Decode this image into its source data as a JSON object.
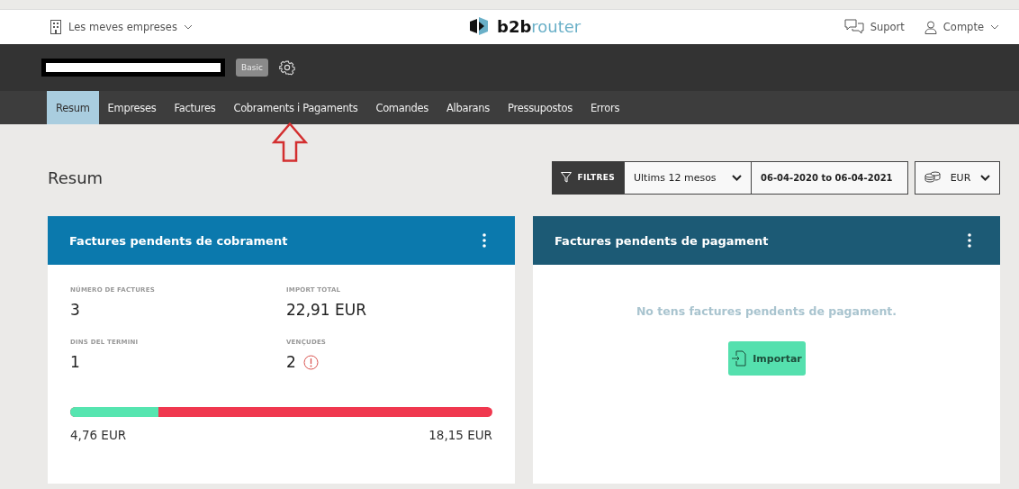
{
  "topbar": {
    "companies_menu": "Les meves empreses",
    "logo": {
      "part_1": "b2b",
      "part_2": "router"
    },
    "support": "Suport",
    "account": "Compte"
  },
  "header": {
    "plan_badge": "Basic"
  },
  "nav": [
    {
      "label": "Resum",
      "selected": true
    },
    {
      "label": "Empreses",
      "selected": false
    },
    {
      "label": "Factures",
      "selected": false
    },
    {
      "label": "Cobraments i Pagaments",
      "selected": false
    },
    {
      "label": "Comandes",
      "selected": false
    },
    {
      "label": "Albarans",
      "selected": false
    },
    {
      "label": "Pressupostos",
      "selected": false
    },
    {
      "label": "Errors",
      "selected": false
    }
  ],
  "page_title": "Resum",
  "filters": {
    "button": "FILTRES",
    "period": "Ultims 12 mesos",
    "date_range": "06-04-2020 to 06-04-2021",
    "currency": "EUR"
  },
  "receivables_card": {
    "title": "Factures pendents de cobrament",
    "stats": [
      {
        "label": "NÚMERO DE FACTURES",
        "value": "3",
        "warning": false
      },
      {
        "label": "IMPORT TOTAL",
        "value": "22,91 EUR",
        "warning": false
      },
      {
        "label": "DINS DEL TERMINI",
        "value": "1",
        "warning": false
      },
      {
        "label": "VENÇUDES",
        "value": "2",
        "warning": true
      }
    ],
    "progress": {
      "level": 0.21,
      "left_amount": "4,76 EUR",
      "right_amount": "18,15 EUR"
    }
  },
  "payables_card": {
    "title": "Factures pendents de pagament",
    "empty_message": "No tens factures pendents de pagament.",
    "button": "Importar"
  }
}
